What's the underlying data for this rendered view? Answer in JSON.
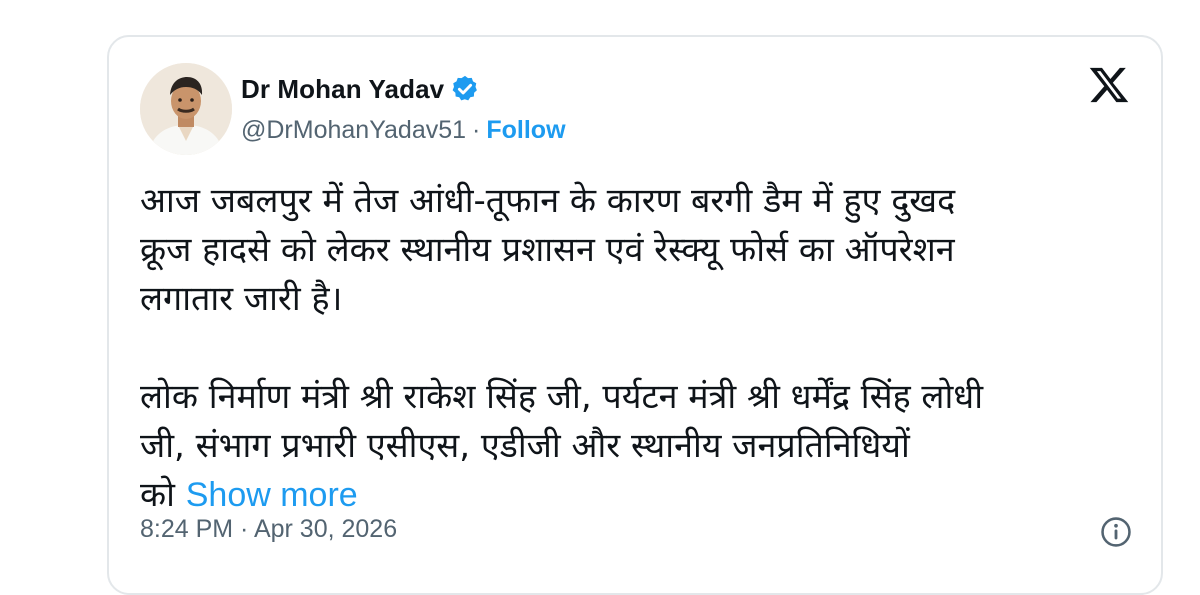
{
  "author": {
    "name": "Dr Mohan Yadav",
    "handle": "@DrMohanYadav51",
    "separator": "·",
    "follow_label": "Follow"
  },
  "tweet": {
    "paragraph_1": "आज जबलपुर में तेज आंधी-तूफान के कारण बरगी डैम में हुए दुखद\nक्रूज हादसे को लेकर स्थानीय प्रशासन एवं रेस्क्यू फोर्स का ऑपरेशन\nलगातार जारी है।",
    "paragraph_2": "लोक निर्माण मंत्री श्री राकेश सिंह जी, पर्यटन मंत्री श्री धर्मेंद्र सिंह लोधी\nजी, संभाग प्रभारी एसीएस, एडीजी और स्थानीय जनप्रतिनिधियों\nको",
    "show_more_label": "Show more",
    "timestamp": "8:24 PM · Apr 30, 2026"
  },
  "icons": {
    "verified": "verified-badge-icon",
    "x_logo": "x-logo-icon",
    "info": "info-icon"
  },
  "colors": {
    "accent": "#1d9bf0",
    "text": "#0f1419",
    "muted": "#536471",
    "border": "#e3e7ea"
  }
}
